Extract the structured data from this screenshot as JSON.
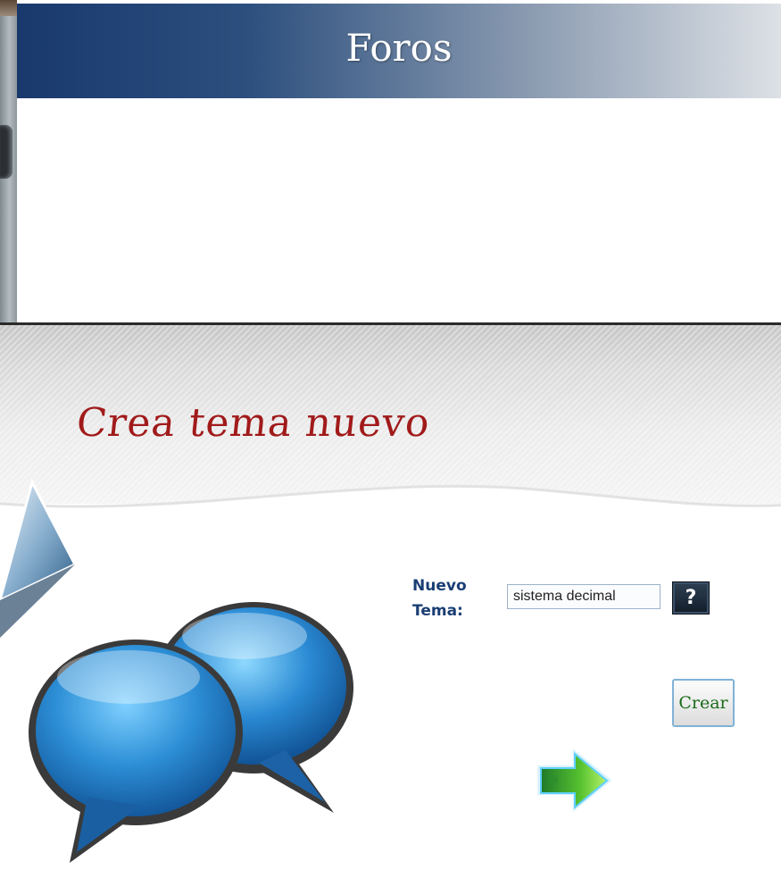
{
  "window": {
    "title": "Foros"
  },
  "form": {
    "heading": "Crea tema nuevo",
    "topic_label_line1": "Nuevo",
    "topic_label_line2": "Tema:",
    "topic_value": "sistema decimal",
    "help_label": "?",
    "create_label": "Crear"
  },
  "icons": {
    "speech_bubbles": "chat-bubbles-icon",
    "triangle": "triangle-icon",
    "next_arrow": "green-arrow-icon"
  },
  "colors": {
    "title_bar_start": "#19396d",
    "heading_red": "#a11a1a",
    "label_blue": "#1a3e74",
    "create_green": "#1a6a1a"
  }
}
